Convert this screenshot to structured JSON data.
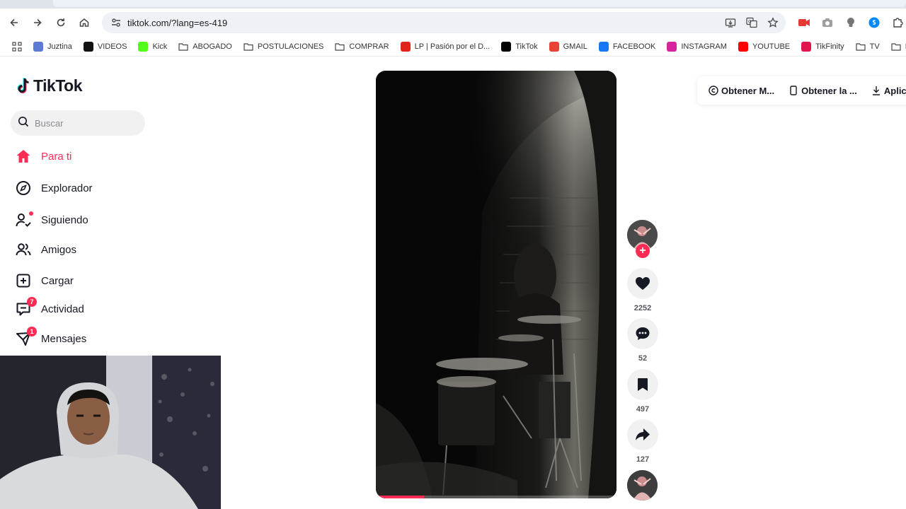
{
  "browser": {
    "url": "tiktok.com/?lang=es-419"
  },
  "bookmarks": [
    {
      "label": "Juztina",
      "icon": "juztina-icon",
      "color": "#5b7bd5"
    },
    {
      "label": "VIDEOS",
      "icon": "videos-icon",
      "color": "#111111"
    },
    {
      "label": "Kick",
      "icon": "kick-icon",
      "color": "#53fc18"
    },
    {
      "label": "ABOGADO",
      "icon": "folder-icon",
      "color": ""
    },
    {
      "label": "POSTULACIONES",
      "icon": "folder-icon",
      "color": ""
    },
    {
      "label": "COMPRAR",
      "icon": "folder-icon",
      "color": ""
    },
    {
      "label": "LP | Pasión por el D...",
      "icon": "lp-icon",
      "color": "#e0241b"
    },
    {
      "label": "TikTok",
      "icon": "tiktok-icon",
      "color": "#000000"
    },
    {
      "label": "GMAIL",
      "icon": "gmail-icon",
      "color": "#ea4335"
    },
    {
      "label": "FACEBOOK",
      "icon": "facebook-icon",
      "color": "#1877f2"
    },
    {
      "label": "INSTAGRAM",
      "icon": "instagram-icon",
      "color": "#d6249f"
    },
    {
      "label": "YOUTUBE",
      "icon": "youtube-icon",
      "color": "#ff0000"
    },
    {
      "label": "TikFinity",
      "icon": "tikfinity-icon",
      "color": "#e3154f"
    },
    {
      "label": "TV",
      "icon": "folder-icon",
      "color": ""
    },
    {
      "label": "HERRA",
      "icon": "folder-icon",
      "color": ""
    }
  ],
  "tiktok": {
    "logo": "TikTok",
    "search_placeholder": "Buscar",
    "nav": [
      {
        "label": "Para ti",
        "icon": "home-icon",
        "active": true
      },
      {
        "label": "Explorador",
        "icon": "compass-icon"
      },
      {
        "label": "Siguiendo",
        "icon": "following-icon"
      },
      {
        "label": "Amigos",
        "icon": "friends-icon"
      },
      {
        "label": "Cargar",
        "icon": "upload-icon"
      },
      {
        "label": "Actividad",
        "icon": "activity-icon",
        "badge": "7"
      },
      {
        "label": "Mensajes",
        "icon": "messages-icon",
        "badge": "1"
      }
    ],
    "top_right": [
      {
        "label": "Obtener M...",
        "icon": "coin-icon"
      },
      {
        "label": "Obtener la ...",
        "icon": "phone-icon"
      },
      {
        "label": "Aplicac",
        "icon": "download-icon"
      }
    ],
    "actions": {
      "likes": "2252",
      "comments": "52",
      "saves": "497",
      "shares": "127"
    },
    "video_progress": 0.2,
    "accent_color": "#fe2c55"
  }
}
